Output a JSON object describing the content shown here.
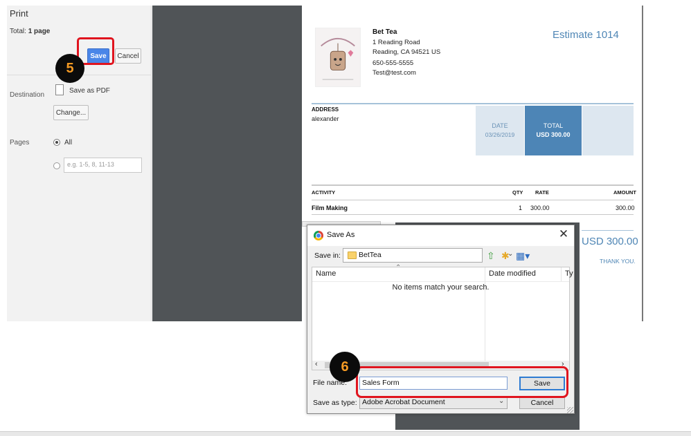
{
  "print_panel": {
    "title": "Print",
    "total_prefix": "Total:",
    "total_value": "1 page",
    "save_label": "Save",
    "cancel_label": "Cancel",
    "destination_label": "Destination",
    "destination_value": "Save as PDF",
    "change_label": "Change...",
    "pages_label": "Pages",
    "pages_all_label": "All",
    "pages_custom_placeholder": "e.g. 1-5, 8, 11-13"
  },
  "steps": {
    "step5": "5",
    "step6": "6"
  },
  "invoice": {
    "company_name": "Bet Tea",
    "address_line1": "1 Reading Road",
    "address_line2": "Reading, CA  94521 US",
    "phone": "650-555-5555",
    "email": "Test@test.com",
    "title": "Estimate  1014",
    "address_label": "ADDRESS",
    "address_name": "alexander",
    "date_label": "DATE",
    "date_value": "03/26/2019",
    "total_label": "TOTAL",
    "total_value": "USD 300.00",
    "columns": {
      "activity": "ACTIVITY",
      "qty": "QTY",
      "rate": "RATE",
      "amount": "AMOUNT"
    },
    "rows": [
      {
        "activity": "Film Making",
        "qty": "1",
        "rate": "300.00",
        "amount": "300.00"
      }
    ],
    "grand_total": "USD 300.00",
    "thank_you": "THANK YOU."
  },
  "dialog": {
    "title": "Save As",
    "save_in_label": "Save in:",
    "save_in_value": "BetTea",
    "col_name": "Name",
    "col_date": "Date modified",
    "col_type": "Ty",
    "empty_message": "No items match your search.",
    "file_name_label": "File name:",
    "file_name_value": "Sales Form",
    "save_as_type_label": "Save as type:",
    "save_as_type_value": "Adobe Acrobat Document",
    "save_label": "Save",
    "cancel_label": "Cancel"
  },
  "colors": {
    "accent_blue": "#4a86e8",
    "highlight_red": "#e0141e",
    "badge_orange": "#f59a23",
    "invoice_blue": "#4f86b5"
  }
}
